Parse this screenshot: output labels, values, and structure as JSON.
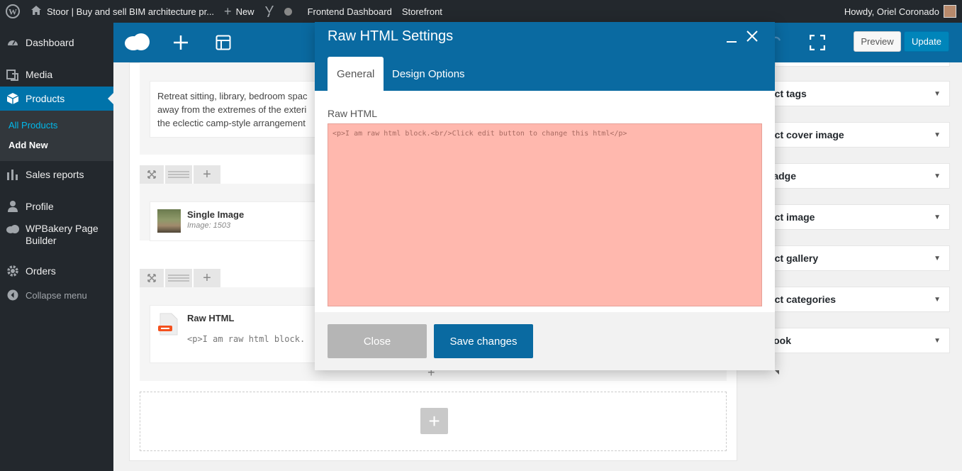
{
  "adminbar": {
    "site_title": "Stoor | Buy and sell BIM architecture pr...",
    "new_label": "New",
    "frontend_dashboard": "Frontend Dashboard",
    "storefront": "Storefront",
    "howdy": "Howdy, Oriel Coronado"
  },
  "sidebar": {
    "dashboard": "Dashboard",
    "media": "Media",
    "products": "Products",
    "all_products": "All Products",
    "add_new": "Add New",
    "sales_reports": "Sales reports",
    "profile": "Profile",
    "wpbakery_line1": "WPBakery Page",
    "wpbakery_line2": "Builder",
    "orders": "Orders",
    "collapse": "Collapse menu"
  },
  "toolbar": {
    "preview_label": "Preview",
    "update_label": "Update"
  },
  "editor": {
    "text_block_lines": [
      "Retreat sitting, library, bedroom spac",
      "away from the extremes of the exteri",
      "the eclectic camp-style arrangement"
    ],
    "single_image_title": "Single Image",
    "single_image_sub": "Image: 1503",
    "raw_html_title": "Raw HTML",
    "raw_html_preview": "<p>I am raw html block."
  },
  "side_panels": [
    "oduct tags",
    "oduct cover image",
    "w badge",
    "oduct image",
    "oduct gallery",
    "oduct categories",
    "cebook"
  ],
  "modal": {
    "title": "Raw HTML Settings",
    "tab_general": "General",
    "tab_design": "Design Options",
    "field_label": "Raw HTML",
    "textarea_value": "<p>I am raw html block.<br/>Click edit button to change this html</p>",
    "close_label": "Close",
    "save_label": "Save changes"
  },
  "colors": {
    "admin_dark": "#23282d",
    "wp_blue": "#0073aa",
    "vc_blue": "#0a6aa1",
    "textarea_bg": "#ffb8ae"
  }
}
